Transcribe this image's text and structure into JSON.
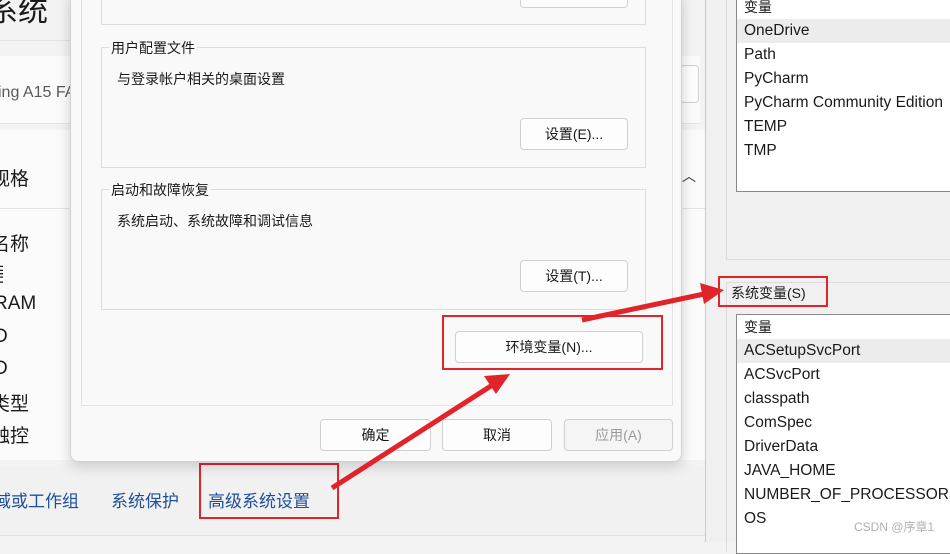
{
  "background": {
    "title": "系统",
    "device_text": "ing A15 FA",
    "spec_heading": "规格",
    "spec_rows": [
      "名称",
      "号",
      "RAM",
      "D",
      "D",
      "类型",
      "触控"
    ],
    "links": [
      "域或工作组",
      "系统保护",
      "高级系统设置"
    ]
  },
  "dialog": {
    "user_profile": {
      "label": "用户配置文件",
      "desc": "与登录帐户相关的桌面设置",
      "button": "设置(E)..."
    },
    "startup": {
      "label": "启动和故障恢复",
      "desc": "系统启动、系统故障和调试信息",
      "button": "设置(T)..."
    },
    "env_button": "环境变量(N)...",
    "ok": "确定",
    "cancel": "取消",
    "apply": "应用(A)"
  },
  "env": {
    "user_vars": {
      "header": "变量",
      "items": [
        "OneDrive",
        "Path",
        "PyCharm",
        "PyCharm Community Edition",
        "TEMP",
        "TMP"
      ],
      "selected": "OneDrive"
    },
    "system_label": "系统变量(S)",
    "system_vars": {
      "header": "变量",
      "items": [
        "ACSetupSvcPort",
        "ACSvcPort",
        "classpath",
        "ComSpec",
        "DriverData",
        "JAVA_HOME",
        "NUMBER_OF_PROCESSORS",
        "OS"
      ],
      "selected": "ACSetupSvcPort"
    }
  },
  "watermark": "CSDN @序章1",
  "colors": {
    "annotation": "#e2242a",
    "link": "#1f4e9a"
  }
}
